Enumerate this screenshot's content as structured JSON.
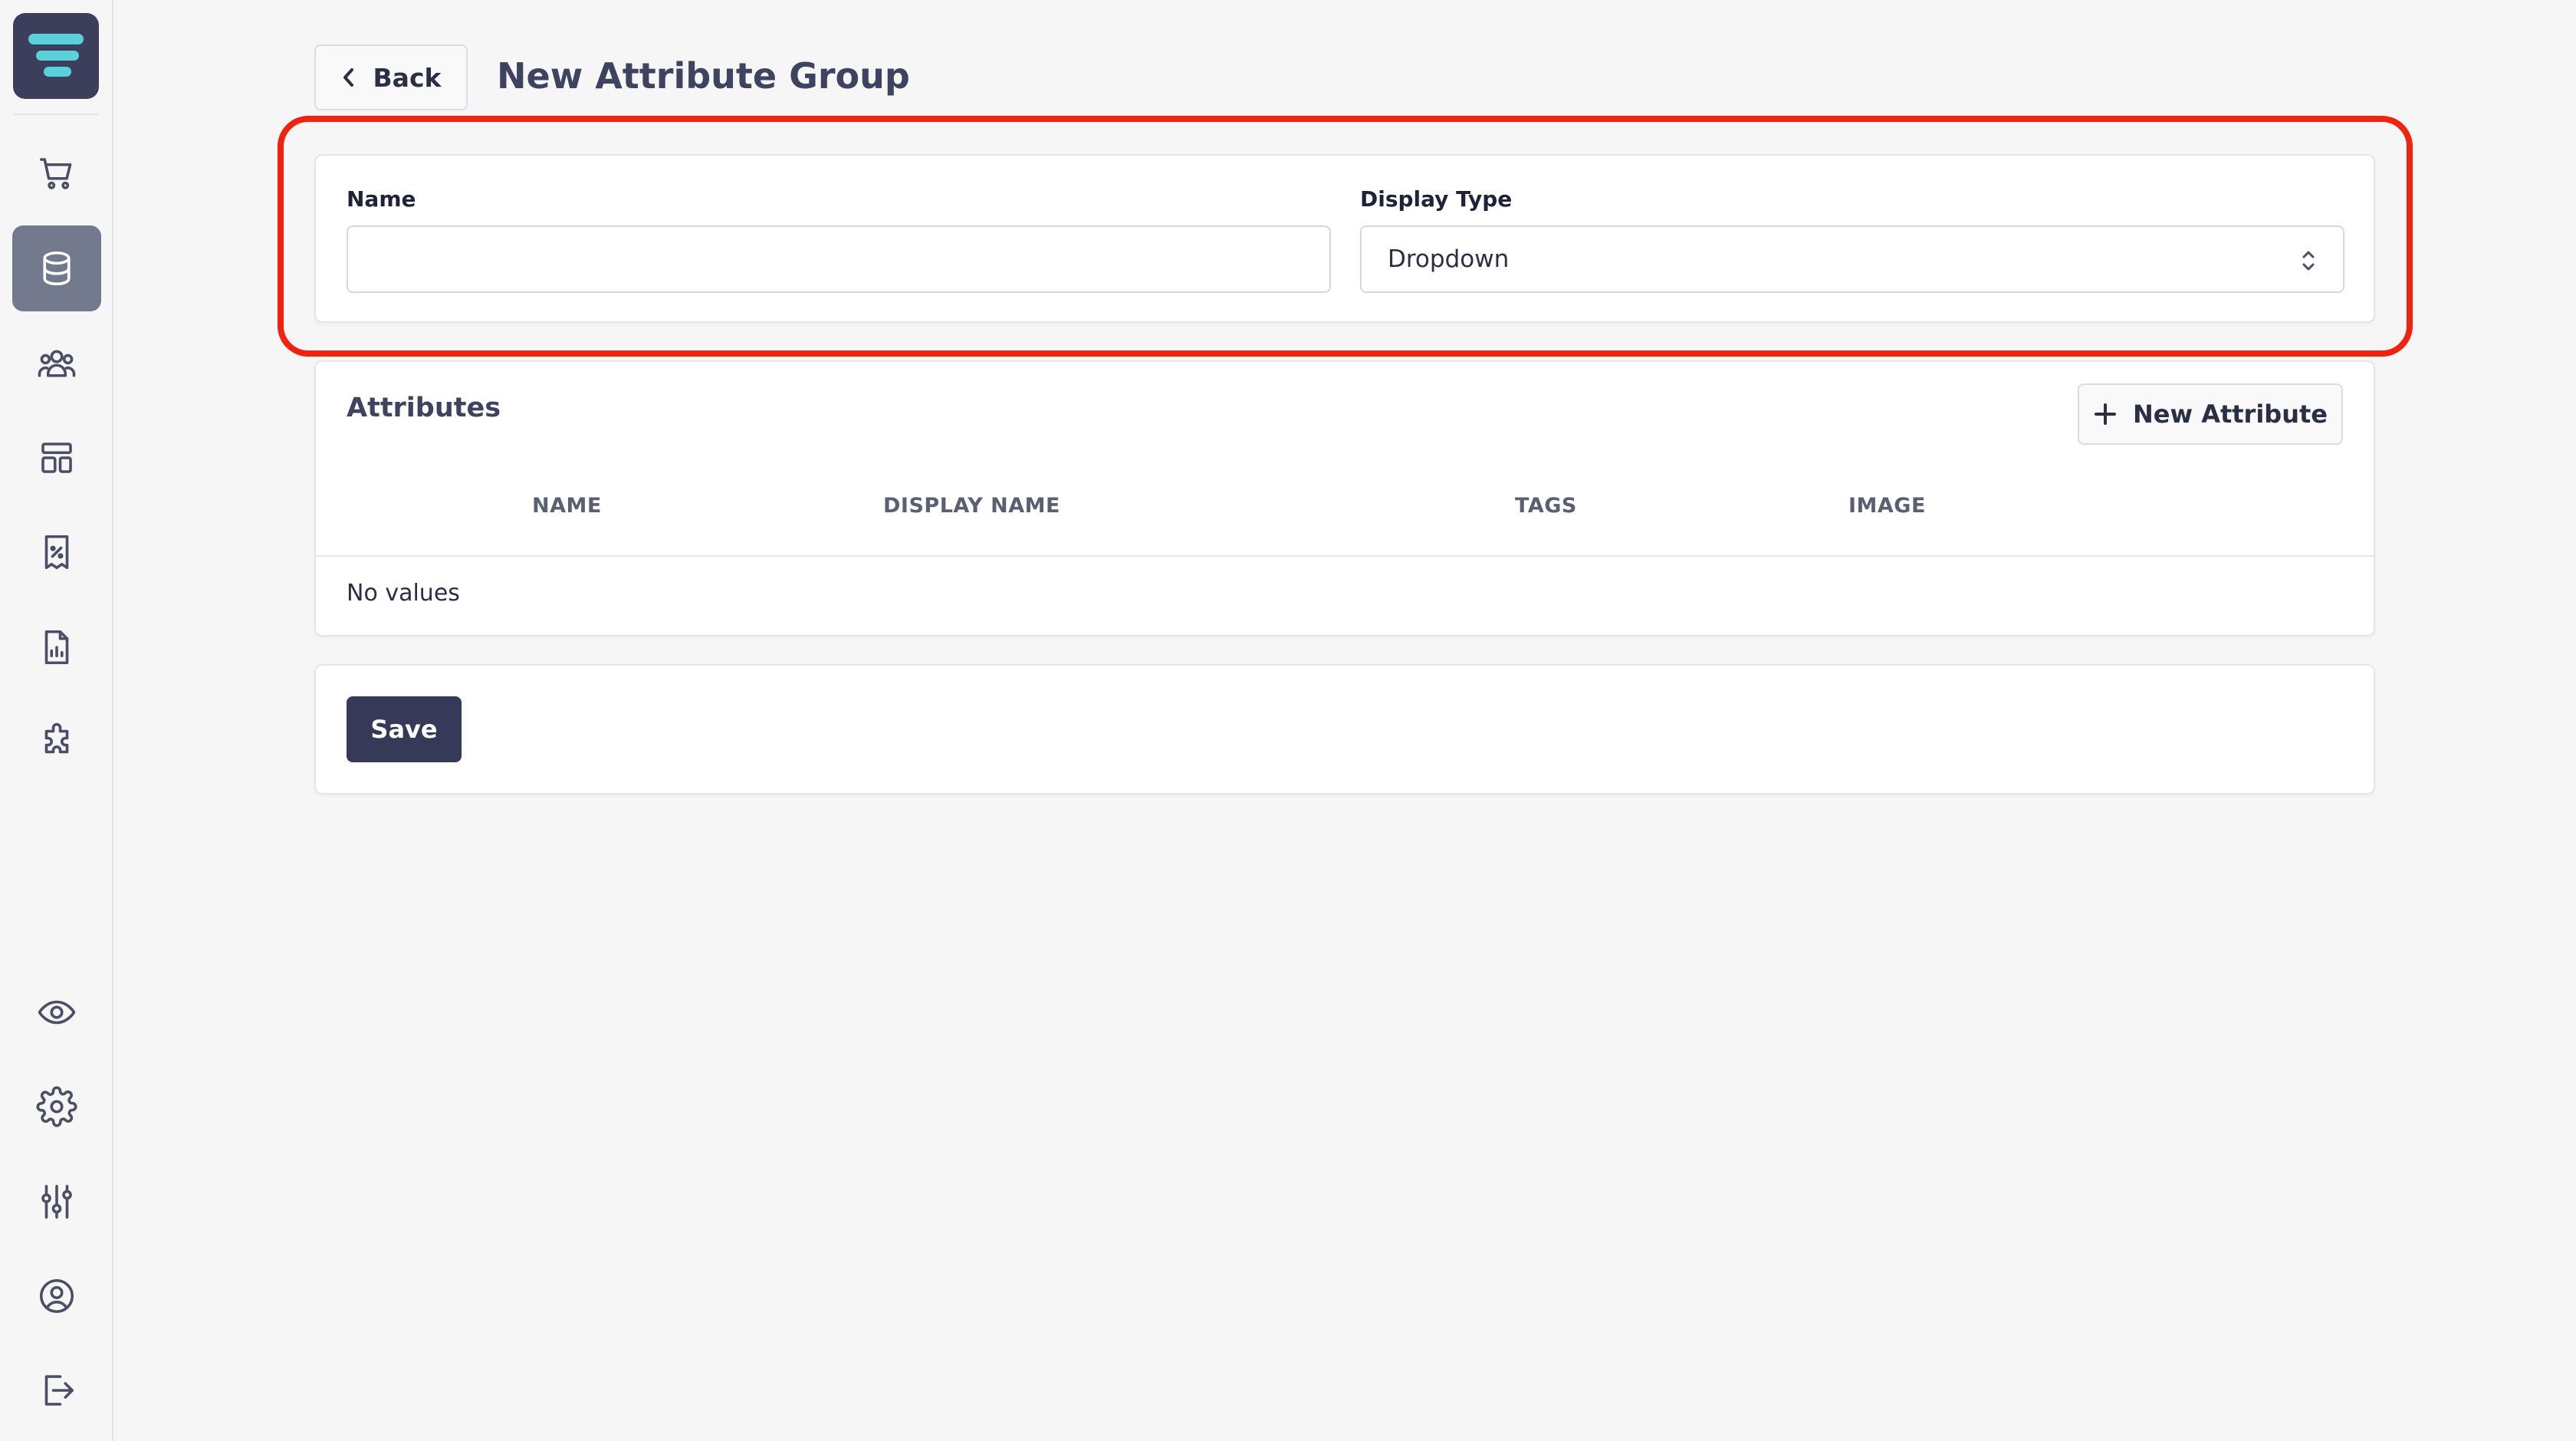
{
  "sidebar": {
    "logo": "logo-icon",
    "items": [
      {
        "name": "cart",
        "icon": "cart-icon"
      },
      {
        "name": "database",
        "icon": "database-icon",
        "active": true
      },
      {
        "name": "customers",
        "icon": "users-icon"
      },
      {
        "name": "layout",
        "icon": "layout-icon"
      },
      {
        "name": "discounts",
        "icon": "receipt-percent-icon"
      },
      {
        "name": "reports",
        "icon": "report-chart-icon"
      },
      {
        "name": "plugins",
        "icon": "puzzle-icon"
      },
      {
        "name": "preview",
        "icon": "eye-icon"
      },
      {
        "name": "settings",
        "icon": "gear-icon"
      },
      {
        "name": "adjustments",
        "icon": "sliders-icon"
      },
      {
        "name": "account",
        "icon": "user-circle-icon"
      },
      {
        "name": "logout",
        "icon": "logout-icon"
      }
    ]
  },
  "header": {
    "back_label": "Back",
    "title": "New Attribute Group"
  },
  "form": {
    "name_label": "Name",
    "name_value": "",
    "display_type_label": "Display Type",
    "display_type_value": "Dropdown"
  },
  "attributes": {
    "title": "Attributes",
    "new_button_label": "New Attribute",
    "columns": [
      "NAME",
      "DISPLAY NAME",
      "TAGS",
      "IMAGE"
    ],
    "empty_text": "No values"
  },
  "actions": {
    "save_label": "Save"
  },
  "colors": {
    "accent": "#363a58",
    "highlight": "#f0230f",
    "active_nav": "#747a8d",
    "logo_mark": "#5ad1d8"
  }
}
